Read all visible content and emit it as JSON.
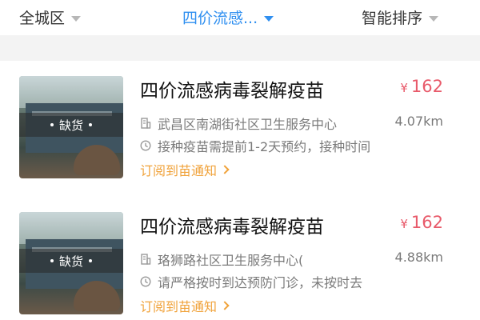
{
  "filters": [
    {
      "label": "全城区",
      "active": false
    },
    {
      "label": "四价流感...",
      "active": true
    },
    {
      "label": "智能排序",
      "active": false
    }
  ],
  "items": [
    {
      "title": "四价流感病毒裂解疫苗",
      "currency": "¥",
      "price": "162",
      "stock_status": "缺货",
      "address": "武昌区南湖街社区卫生服务中心",
      "distance": "4.07km",
      "note": "接种疫苗需提前1-2天预约，接种时间",
      "subscribe": "订阅到苗通知"
    },
    {
      "title": "四价流感病毒裂解疫苗",
      "currency": "¥",
      "price": "162",
      "stock_status": "缺货",
      "address": "珞狮路社区卫生服务中心(",
      "distance": "4.88km",
      "note": "请严格按时到达预防门诊，未按时去",
      "subscribe": "订阅到苗通知"
    }
  ],
  "colors": {
    "accent": "#2f8ff0",
    "price": "#e85a6a",
    "subscribe": "#f0a23a"
  },
  "icons": {
    "caret": "caret-down-icon",
    "address": "building-icon",
    "note": "clock-icon",
    "subscribe": "chevron-right-icon"
  }
}
